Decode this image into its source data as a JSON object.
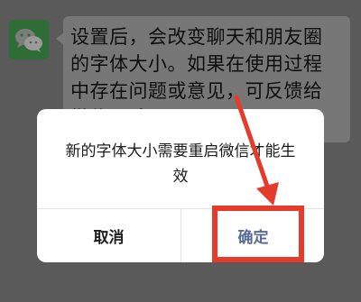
{
  "chat": {
    "message": "设置后，会改变聊天和朋友圈\n的字体大小。如果在使用过程\n中存在问题或意见，可反馈给\n微信团队"
  },
  "dialog": {
    "message": "新的字体大小需要重启微信才能生效",
    "cancel_label": "取消",
    "confirm_label": "确定"
  },
  "colors": {
    "overlay": "#5a5a5a",
    "confirm_text": "#586b95",
    "annotation": "#e53b2a",
    "avatar_green": "#2f6d37"
  },
  "icons": {
    "avatar": "wechat-logo-icon"
  }
}
